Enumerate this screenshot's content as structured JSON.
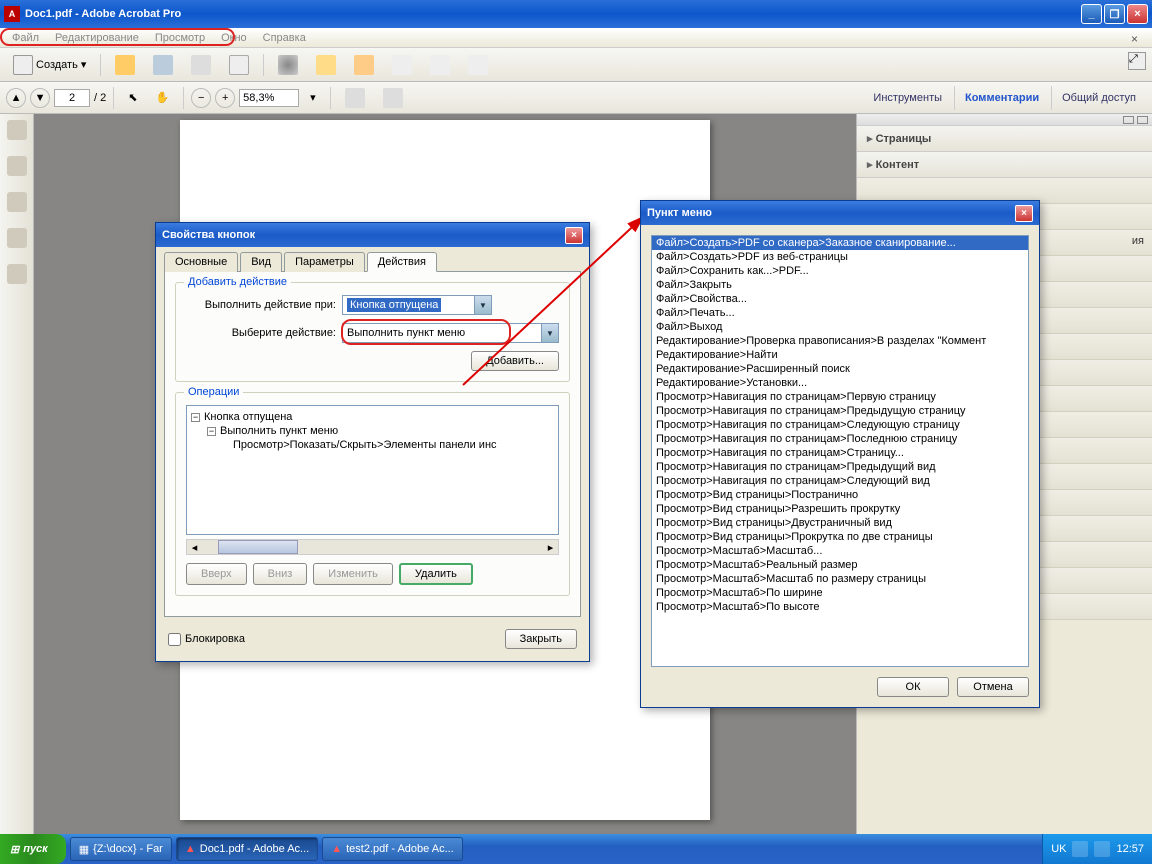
{
  "titlebar": {
    "title": "Doc1.pdf - Adobe Acrobat Pro"
  },
  "menubar": {
    "items": [
      "Файл",
      "Редактирование",
      "Просмотр",
      "Окно",
      "Справка"
    ]
  },
  "toolbar": {
    "create": "Создать"
  },
  "toolbar2": {
    "page_current": "2",
    "page_total": "/ 2",
    "zoom": "58,3%",
    "links": [
      "Инструменты",
      "Комментарии",
      "Общий доступ"
    ]
  },
  "rightpanel": {
    "sections": [
      "Страницы",
      "Контент"
    ],
    "truncated_label": "ия"
  },
  "dlg_props": {
    "title": "Свойства кнопок",
    "tabs": [
      "Основные",
      "Вид",
      "Параметры",
      "Действия"
    ],
    "group_add": "Добавить действие",
    "label_trigger": "Выполнить действие при:",
    "sel_trigger": "Кнопка отпущена",
    "label_action": "Выберите действие:",
    "sel_action": "Выполнить пункт меню",
    "btn_add": "Добавить...",
    "group_ops": "Операции",
    "tree": {
      "root": "Кнопка отпущена",
      "child": "Выполнить пункт меню",
      "leaf": "Просмотр>Показать/Скрыть>Элементы панели инс"
    },
    "btn_up": "Вверх",
    "btn_down": "Вниз",
    "btn_edit": "Изменить",
    "btn_del": "Удалить",
    "chk_lock": "Блокировка",
    "btn_close": "Закрыть"
  },
  "dlg_menu": {
    "title": "Пункт меню",
    "items": [
      "Файл>Создать>PDF со сканера>Заказное сканирование...",
      "Файл>Создать>PDF из веб-страницы",
      "Файл>Сохранить как...>PDF...",
      "Файл>Закрыть",
      "Файл>Свойства...",
      "Файл>Печать...",
      "Файл>Выход",
      "Редактирование>Проверка правописания>В разделах \"Коммент",
      "Редактирование>Найти",
      "Редактирование>Расширенный поиск",
      "Редактирование>Установки...",
      "Просмотр>Навигация по страницам>Первую страницу",
      "Просмотр>Навигация по страницам>Предыдущую страницу",
      "Просмотр>Навигация по страницам>Следующую страницу",
      "Просмотр>Навигация по страницам>Последнюю страницу",
      "Просмотр>Навигация по страницам>Страницу...",
      "Просмотр>Навигация по страницам>Предыдущий вид",
      "Просмотр>Навигация по страницам>Следующий вид",
      "Просмотр>Вид страницы>Постранично",
      "Просмотр>Вид страницы>Разрешить прокрутку",
      "Просмотр>Вид страницы>Двустраничный вид",
      "Просмотр>Вид страницы>Прокрутка по две страницы",
      "Просмотр>Масштаб>Масштаб...",
      "Просмотр>Масштаб>Реальный размер",
      "Просмотр>Масштаб>Масштаб по размеру страницы",
      "Просмотр>Масштаб>По ширине",
      "Просмотр>Масштаб>По высоте"
    ],
    "btn_ok": "ОК",
    "btn_cancel": "Отмена"
  },
  "taskbar": {
    "start": "пуск",
    "tasks": [
      "{Z:\\docx} - Far",
      "Doc1.pdf - Adobe Ac...",
      "test2.pdf - Adobe Ac..."
    ],
    "lang": "UK",
    "time": "12:57"
  }
}
